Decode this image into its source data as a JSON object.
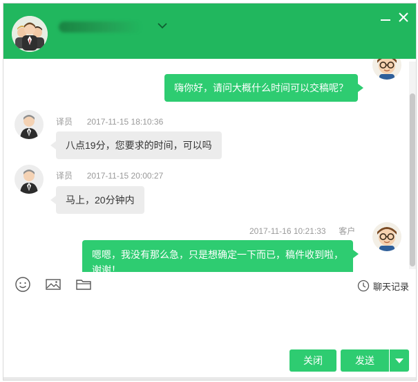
{
  "window": {
    "title_blurred": true
  },
  "messages": [
    {
      "id": "m1",
      "direction": "out",
      "text": "嗨你好，请问大概什么时间可以交稿呢？",
      "avatar": "cartoon-glasses-avatar"
    },
    {
      "id": "m2",
      "direction": "in",
      "sender": "译员",
      "time": "2017-11-15 18:10:36",
      "text": "八点19分，您要求的时间，可以吗",
      "avatar": "businessman-avatar"
    },
    {
      "id": "m3",
      "direction": "in",
      "sender": "译员",
      "time": "2017-11-15 20:00:27",
      "text": "马上，20分钟内",
      "avatar": "businessman-avatar"
    },
    {
      "id": "m4",
      "direction": "out",
      "sender": "客户",
      "time": "2017-11-16 10:21:33",
      "text_line1": "嗯嗯，我没有那么急，只是想确定一下而已，稿件收到啦，",
      "text_line2": "谢谢！",
      "avatar": "cartoon-glasses-avatar"
    }
  ],
  "toolbar": {
    "icons": [
      "smiley-icon",
      "image-icon",
      "folder-icon"
    ],
    "history_label": "聊天记录"
  },
  "buttons": {
    "close_label": "关闭",
    "send_label": "发送"
  },
  "colors": {
    "header": "#21b75e",
    "outgoing_bubble": "#2ecc71",
    "incoming_bubble": "#ececec"
  }
}
